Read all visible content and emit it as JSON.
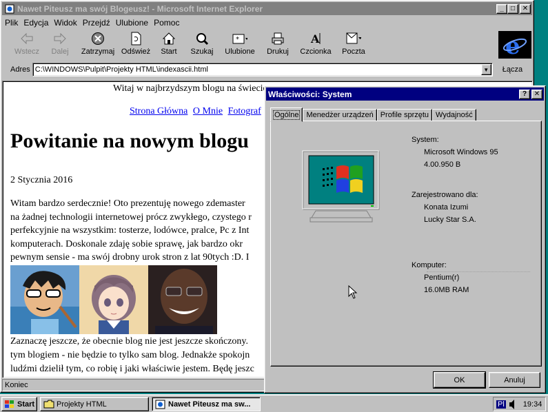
{
  "ie_window": {
    "title": "Nawet Piteusz ma swój Blogeusz! - Microsoft Internet Explorer",
    "menu": [
      "Plik",
      "Edycja",
      "Widok",
      "Przejdź",
      "Ulubione",
      "Pomoc"
    ],
    "toolbar": [
      {
        "label": "Wstecz",
        "icon": "back-arrow-icon",
        "enabled": false
      },
      {
        "label": "Dalej",
        "icon": "forward-arrow-icon",
        "enabled": false
      },
      {
        "label": "Zatrzymaj",
        "icon": "stop-icon",
        "enabled": true
      },
      {
        "label": "Odśwież",
        "icon": "refresh-icon",
        "enabled": true
      },
      {
        "label": "Start",
        "icon": "home-icon",
        "enabled": true
      },
      {
        "label": "Szukaj",
        "icon": "search-icon",
        "enabled": true
      },
      {
        "label": "Ulubione",
        "icon": "favorites-icon",
        "enabled": true
      },
      {
        "label": "Drukuj",
        "icon": "print-icon",
        "enabled": true
      },
      {
        "label": "Czcionka",
        "icon": "font-icon",
        "enabled": true
      },
      {
        "label": "Poczta",
        "icon": "mail-icon",
        "enabled": true
      }
    ],
    "address_label": "Adres",
    "address_value": "C:\\WINDOWS\\Pulpit\\Projekty HTML\\indexascii.html",
    "links_label": "Łącza",
    "status_text": "Koniec"
  },
  "page": {
    "welcome_text": "Witaj w najbrzydszym blogu na świe",
    "welcome_tail": "cie",
    "nav_links": [
      "Strona Główna",
      "O Mnie",
      "Fotograf"
    ],
    "heading": "Powitanie na nowym blogu",
    "date": "2 Stycznia 2016",
    "paragraph_lines": [
      "Witam bardzo serdecznie! Oto prezentuję nowego zdemaster",
      "na żadnej technologii internetowej prócz zwykłego, czystego r",
      "perfekcyjnie na wszystkim: tosterze, lodówce, pralce, Pc z Int",
      "komputerach. Doskonale zdaję sobie sprawę, jak bardzo okr",
      "pewnym sensie - ma swój drobny urok stron z lat 90tych :D. I"
    ],
    "paragraph2_lines": [
      "Zaznaczę jeszcze, że obecnie blog nie jest jeszcze skończony.",
      "tym blogiem - nie będzie to tylko sam blog. Jednakże spokojn",
      "ludźmi dzielił tym, co robię i jaki właściwie jestem. Będę jeszc"
    ]
  },
  "dialog": {
    "title": "Właściwości: System",
    "tabs": [
      "Ogólne",
      "Menedżer urządzeń",
      "Profile sprzętu",
      "Wydajność"
    ],
    "active_tab": "Ogólne",
    "system_label": "System:",
    "system_lines": [
      "Microsoft Windows 95",
      "4.00.950 B"
    ],
    "registered_label": "Zarejestrowano dla:",
    "registered_lines": [
      "Konata Izumi",
      "Lucky Star S.A."
    ],
    "computer_label": "Komputer:",
    "computer_lines": [
      "Pentium(r)",
      "16.0MB RAM"
    ],
    "ok_label": "OK",
    "cancel_label": "Anuluj"
  },
  "taskbar": {
    "start_label": "Start",
    "tasks": [
      "Projekty HTML",
      "Nawet Piteusz ma sw..."
    ],
    "tray_lang": "Pl",
    "clock": "19:34"
  },
  "colors": {
    "desktop": "#008080",
    "active_title": "#000080",
    "inactive_title": "#808080",
    "link": "#0000ee"
  }
}
